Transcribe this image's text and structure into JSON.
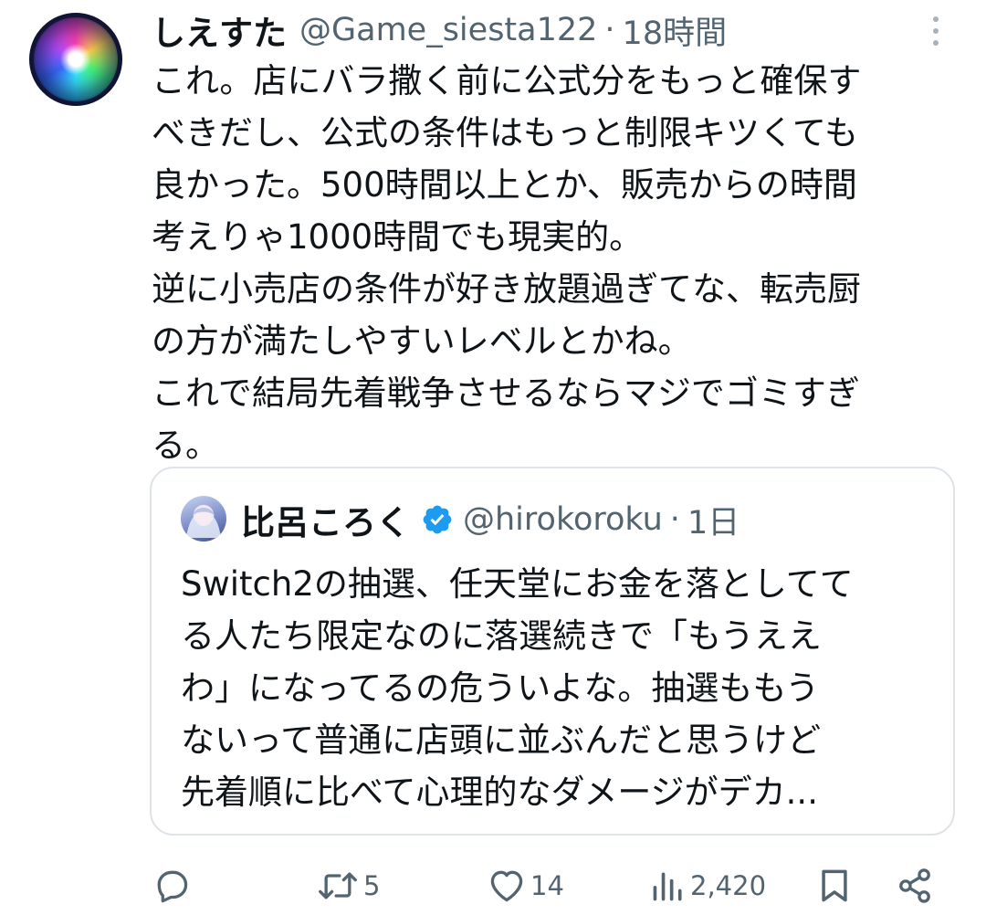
{
  "tweet": {
    "display_name": "しえすた",
    "handle": "@Game_siesta122",
    "separator": "·",
    "time": "18時間",
    "text_lines": [
      "これ。店にバラ撒く前に公式分をもっと確保す",
      "べきだし、公式の条件はもっと制限キツくても",
      "良かった。500時間以上とか、販売からの時間",
      "考えりゃ1000時間でも現実的。",
      "逆に小売店の条件が好き放題過ぎてな、転売厨",
      "の方が満たしやすいレベルとかね。",
      "これで結局先着戦争させるならマジでゴミすぎ",
      "る。"
    ]
  },
  "quoted_tweet": {
    "display_name": "比呂ころく",
    "handle": "@hirokoroku",
    "separator": "·",
    "time": "1日",
    "verified_color": "#1d9bf0",
    "text_lines": [
      "Switch2の抽選、任天堂にお金を落としてて",
      "る人たち限定なのに落選続きで「もうええ",
      "わ」になってるの危ういよな。抽選ももう",
      "ないって普通に店頭に並ぶんだと思うけど",
      "先着順に比べて心理的なダメージがデカ..."
    ]
  },
  "actions": {
    "reply_icon": "reply-icon",
    "retweet_icon": "retweet-icon",
    "retweet_count": "5",
    "like_icon": "heart-icon",
    "like_count": "14",
    "views_icon": "views-icon",
    "views_count": "2,420",
    "bookmark_icon": "bookmark-icon",
    "share_icon": "share-icon"
  },
  "colors": {
    "text": "#0f1419",
    "secondary_text": "#536471",
    "border": "#dde3e8",
    "verified": "#1d9bf0"
  }
}
